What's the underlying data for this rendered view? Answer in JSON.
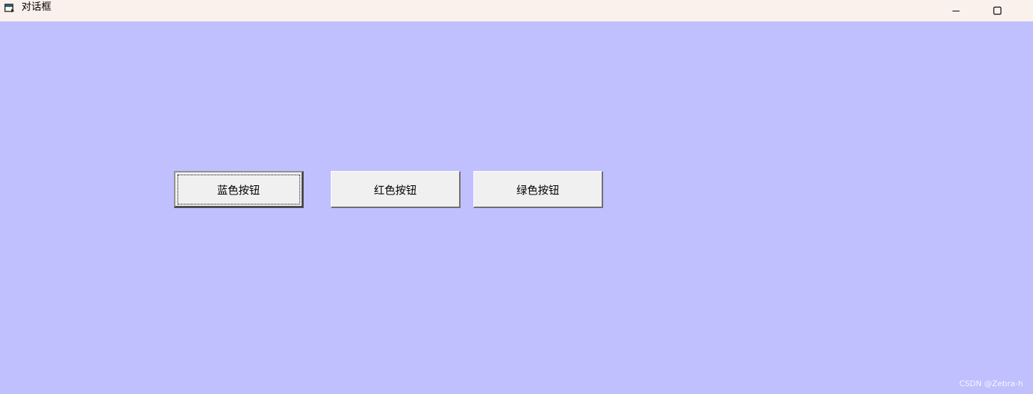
{
  "window": {
    "title": "对话框",
    "icon": "dialog-app-icon",
    "controls": {
      "minimize_icon": "minimize-icon",
      "maximize_icon": "maximize-icon"
    }
  },
  "client": {
    "background": "#c0c0ff",
    "buttons": [
      {
        "label": "蓝色按钮",
        "focused": true
      },
      {
        "label": "红色按钮",
        "focused": false
      },
      {
        "label": "绿色按钮",
        "focused": false
      }
    ]
  },
  "watermark": {
    "text": "CSDN @Zebra-h"
  },
  "colors": {
    "titlebar": "#fbf1ec",
    "client_background": "#c0c0ff",
    "button_face": "#f0f0f0"
  }
}
